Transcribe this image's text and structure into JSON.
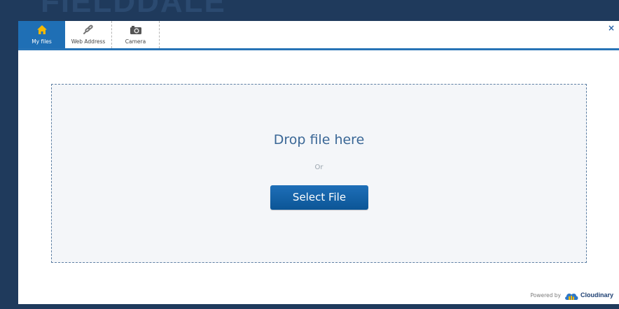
{
  "background": {
    "logo_text": "FIELDDALE"
  },
  "tabs": [
    {
      "label": "My files",
      "icon": "home-icon",
      "active": true
    },
    {
      "label": "Web Address",
      "icon": "link-icon",
      "active": false
    },
    {
      "label": "Camera",
      "icon": "camera-icon",
      "active": false
    }
  ],
  "close_label": "×",
  "dropzone": {
    "title": "Drop file here",
    "or_text": "Or",
    "button_label": "Select File"
  },
  "footer": {
    "powered_by": "Powered by",
    "brand": "Cloudinary"
  },
  "colors": {
    "page_background": "#1f3a5c",
    "active_tab": "#1f6fb5",
    "accent": "#2773b6",
    "button": "#0c5596",
    "dropzone_bg": "#f4f6f9",
    "home_icon": "#f5b800"
  }
}
